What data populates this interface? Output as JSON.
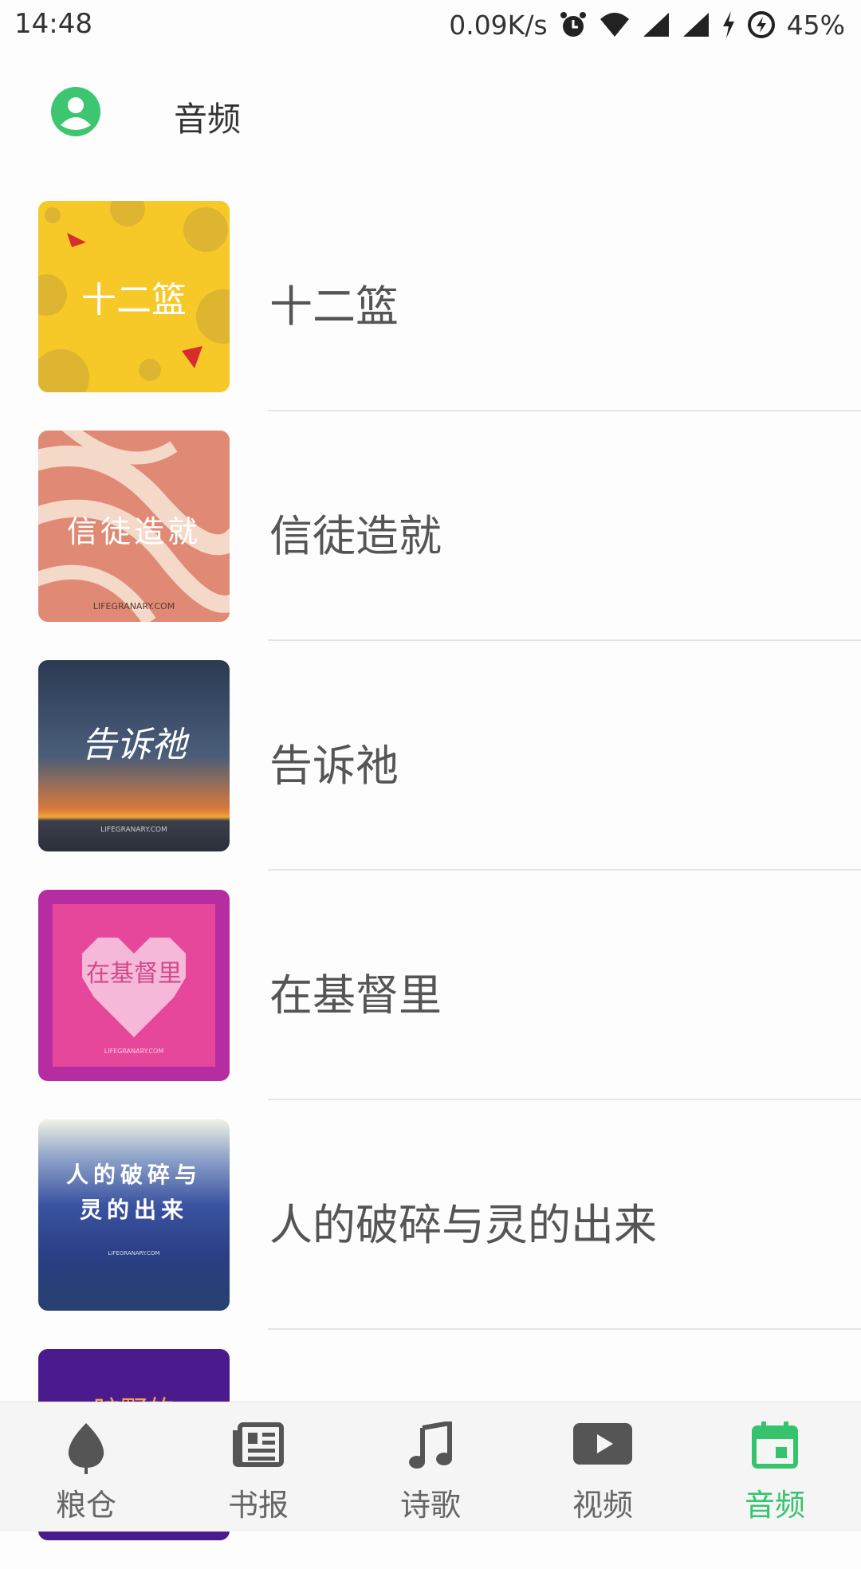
{
  "status_bar": {
    "time": "14:48",
    "net_speed": "0.09K/s",
    "battery": "45%",
    "icons": [
      "alarm-icon",
      "wifi-icon",
      "signal-icon",
      "signal-icon",
      "charging-icon",
      "battery-icon"
    ]
  },
  "app_bar": {
    "title": "音频",
    "avatar_color": "#3cc66f"
  },
  "list": {
    "items": [
      {
        "title": "十二篮",
        "thumb_text": "十二篮"
      },
      {
        "title": "信徒造就",
        "thumb_text": "信徒造就",
        "thumb_site": "LIFEGRANARY.COM"
      },
      {
        "title": "告诉祂",
        "thumb_text": "告诉祂",
        "thumb_site": "LIFEGRANARY.COM"
      },
      {
        "title": "在基督里",
        "thumb_text": "在基督里",
        "thumb_site": "LIFEGRANARY.COM"
      },
      {
        "title": "人的破碎与灵的出来",
        "thumb_text": "人的破碎与\n灵的出来",
        "thumb_site": "LIFEGRANARY.COM"
      },
      {
        "title": "",
        "thumb_text": "旷野的"
      }
    ]
  },
  "bottom_nav": {
    "active_color": "#35c46b",
    "items": [
      {
        "label": "粮仓",
        "icon": "leaf-icon"
      },
      {
        "label": "书报",
        "icon": "newspaper-icon"
      },
      {
        "label": "诗歌",
        "icon": "music-note-icon"
      },
      {
        "label": "视频",
        "icon": "play-icon"
      },
      {
        "label": "音频",
        "icon": "calendar-icon",
        "active": true
      }
    ]
  }
}
